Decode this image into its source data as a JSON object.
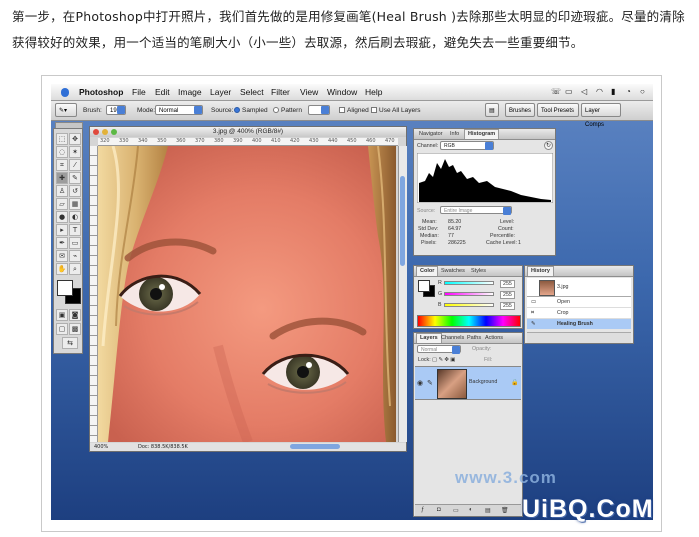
{
  "intro_text": "第一步，在Photoshop中打开照片，我们首先做的是用修复画笔(Heal Brush )去除那些太明显的印迹瑕疵。尽量的清除获得较好的效果，用一个适当的笔刷大小（小一些）去取源，然后刷去瑕疵，避免失去一些重要细节。",
  "menubar": {
    "app": "Photoshop",
    "items": [
      "File",
      "Edit",
      "Image",
      "Layer",
      "Select",
      "Filter",
      "View",
      "Window",
      "Help"
    ]
  },
  "options_bar": {
    "brush_label": "Brush:",
    "brush_size": "19",
    "mode_label": "Mode:",
    "mode_value": "Normal",
    "source_label": "Source:",
    "sampled_label": "Sampled",
    "pattern_label": "Pattern",
    "aligned_label": "Aligned",
    "use_all_layers_label": "Use All Layers",
    "palette_well": [
      "Brushes",
      "Tool Presets",
      "Layer Comps"
    ]
  },
  "document": {
    "title": "3.jpg @ 400% (RGB/8#)",
    "ruler_marks": [
      "320",
      "330",
      "340",
      "350",
      "360",
      "370",
      "380",
      "390",
      "400",
      "410",
      "420",
      "430",
      "440",
      "450",
      "460",
      "470"
    ],
    "zoom": "400%",
    "doc_size": "Doc: 838.5K/838.5K"
  },
  "histogram_panel": {
    "tabs": [
      "Navigator",
      "Info",
      "Histogram"
    ],
    "channel_label": "Channel:",
    "channel_value": "RGB",
    "source_label": "Source:",
    "source_value": "Entire Image",
    "stats": [
      {
        "label": "Mean:",
        "value": "85.20"
      },
      {
        "label": "Std Dev:",
        "value": "64.97"
      },
      {
        "label": "Median:",
        "value": "77"
      },
      {
        "label": "Pixels:",
        "value": "286225"
      }
    ],
    "stats_right": [
      {
        "label": "Level:",
        "value": ""
      },
      {
        "label": "Count:",
        "value": ""
      },
      {
        "label": "Percentile:",
        "value": ""
      },
      {
        "label": "Cache Level:",
        "value": "1"
      }
    ]
  },
  "color_panel": {
    "tabs": [
      "Color",
      "Swatches",
      "Styles"
    ],
    "channels": [
      {
        "label": "R",
        "value": "255"
      },
      {
        "label": "G",
        "value": "255"
      },
      {
        "label": "B",
        "value": "255"
      }
    ]
  },
  "history_panel": {
    "tab": "History",
    "snapshot": "3.jpg",
    "steps": [
      "Open",
      "Crop",
      "Healing Brush"
    ]
  },
  "layers_panel": {
    "tabs": [
      "Layers",
      "Channels",
      "Paths",
      "Actions"
    ],
    "blend_mode": "Normal",
    "opacity_label": "Opacity:",
    "lock_label": "Lock:",
    "fill_label": "Fill:",
    "layer_name": "Background"
  },
  "watermarks": {
    "site1": "www.3.com",
    "site2": "UiBQ.CoM"
  }
}
